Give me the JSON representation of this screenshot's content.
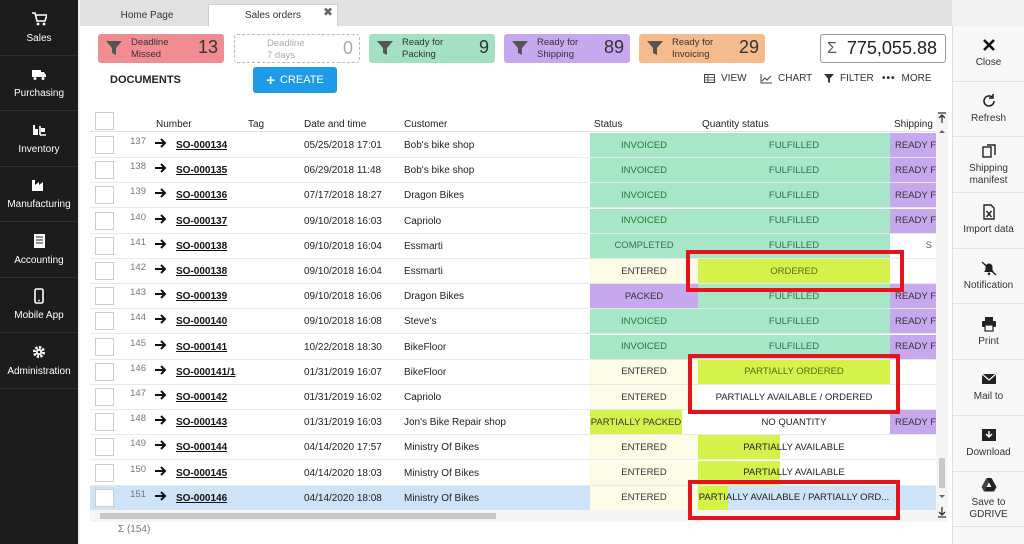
{
  "nav": {
    "items": [
      {
        "label": "Sales",
        "icon": "cart-icon"
      },
      {
        "label": "Purchasing",
        "icon": "truck-icon"
      },
      {
        "label": "Inventory",
        "icon": "forklift-icon"
      },
      {
        "label": "Manufacturing",
        "icon": "factory-icon"
      },
      {
        "label": "Accounting",
        "icon": "ledger-icon"
      },
      {
        "label": "Mobile App",
        "icon": "phone-icon"
      },
      {
        "label": "Administration",
        "icon": "gear-icon"
      }
    ]
  },
  "tabs": {
    "home": "Home Page",
    "sales": "Sales orders",
    "close": "✖"
  },
  "tiles": [
    {
      "line1": "Deadline",
      "line2": "Missed",
      "count": "13",
      "bg": "#f08c92",
      "text": "#333"
    },
    {
      "line1": "Deadline",
      "line2": "7 days",
      "count": "0",
      "bg": "#ffffff",
      "text": "#aaa"
    },
    {
      "line1": "Ready for",
      "line2": "Packing",
      "count": "9",
      "bg": "#a4e0c4",
      "text": "#333"
    },
    {
      "line1": "Ready for",
      "line2": "Shipping",
      "count": "89",
      "bg": "#c7a8ee",
      "text": "#333"
    },
    {
      "line1": "Ready for",
      "line2": "Invoicing",
      "count": "29",
      "bg": "#f6bb8c",
      "text": "#333"
    }
  ],
  "total": {
    "symbol": "Σ",
    "value": "775,055.88"
  },
  "toolbar": {
    "documents": "DOCUMENTS",
    "create": "CREATE",
    "view": "VIEW",
    "chart": "CHART",
    "filter": "FILTER",
    "more": "MORE"
  },
  "columns": {
    "number": "Number",
    "tag": "Tag",
    "datetime": "Date and time",
    "customer": "Customer",
    "status": "Status",
    "qty": "Quantity status",
    "shipping": "Shipping"
  },
  "colors": {
    "invoiced": "#a8e6c8",
    "fulfilled": "#a8e6c8",
    "completed": "#a8e6c8",
    "packed": "#c7a8ee",
    "ready": "#c7a8ee",
    "entered": "#fcfbe6",
    "ordered": "#d4f24a",
    "partially_packed": "#d4f24a",
    "highlight": "#e2141d",
    "accent": "#1e9be8"
  },
  "rows": [
    {
      "num": "137",
      "order": "SO-000134",
      "date": "05/25/2018 17:01",
      "customer": "Bob's bike shop",
      "status": "INVOICED",
      "qty": "FULFILLED",
      "ship": "READY F"
    },
    {
      "num": "138",
      "order": "SO-000135",
      "date": "06/29/2018 11:48",
      "customer": "Bob's bike shop",
      "status": "INVOICED",
      "qty": "FULFILLED",
      "ship": "READY F"
    },
    {
      "num": "139",
      "order": "SO-000136",
      "date": "07/17/2018 18:27",
      "customer": "Dragon Bikes",
      "status": "INVOICED",
      "qty": "FULFILLED",
      "ship": "READY F"
    },
    {
      "num": "140",
      "order": "SO-000137",
      "date": "09/10/2018 16:03",
      "customer": "Capriolo",
      "status": "INVOICED",
      "qty": "FULFILLED",
      "ship": "READY F"
    },
    {
      "num": "141",
      "order": "SO-000138",
      "date": "09/10/2018 16:04",
      "customer": "Essmarti",
      "status": "COMPLETED",
      "qty": "FULFILLED",
      "ship": "S"
    },
    {
      "num": "142",
      "order": "SO-000138",
      "date": "09/10/2018 16:04",
      "customer": "Essmarti",
      "status": "ENTERED",
      "qty": "ORDERED",
      "ship": ""
    },
    {
      "num": "143",
      "order": "SO-000139",
      "date": "09/10/2018 16:06",
      "customer": "Dragon Bikes",
      "status": "PACKED",
      "qty": "FULFILLED",
      "ship": "READY F"
    },
    {
      "num": "144",
      "order": "SO-000140",
      "date": "09/10/2018 16:08",
      "customer": "Steve's",
      "status": "INVOICED",
      "qty": "FULFILLED",
      "ship": "READY F"
    },
    {
      "num": "145",
      "order": "SO-000141",
      "date": "10/22/2018 18:30",
      "customer": "BikeFloor",
      "status": "INVOICED",
      "qty": "FULFILLED",
      "ship": "READY F"
    },
    {
      "num": "146",
      "order": "SO-000141/1",
      "date": "01/31/2019 16:07",
      "customer": "BikeFloor",
      "status": "ENTERED",
      "qty": "PARTIALLY ORDERED",
      "ship": ""
    },
    {
      "num": "147",
      "order": "SO-000142",
      "date": "01/31/2019 16:02",
      "customer": "Capriolo",
      "status": "ENTERED",
      "qty": "PARTIALLY AVAILABLE / ORDERED",
      "ship": ""
    },
    {
      "num": "148",
      "order": "SO-000143",
      "date": "01/31/2019 16:03",
      "customer": "Jon's Bike Repair shop",
      "status": "PARTIALLY PACKED",
      "qty": "NO QUANTITY",
      "ship": "READY F"
    },
    {
      "num": "149",
      "order": "SO-000144",
      "date": "04/14/2020 17:57",
      "customer": "Ministry Of Bikes",
      "status": "ENTERED",
      "qty": "PARTIALLY AVAILABLE",
      "ship": ""
    },
    {
      "num": "150",
      "order": "SO-000145",
      "date": "04/14/2020 18:03",
      "customer": "Ministry Of Bikes",
      "status": "ENTERED",
      "qty": "PARTIALLY AVAILABLE",
      "ship": ""
    },
    {
      "num": "151",
      "order": "SO-000146",
      "date": "04/14/2020 18:08",
      "customer": "Ministry Of Bikes",
      "status": "ENTERED",
      "qty": "PARTIALLY AVAILABLE / PARTIALLY ORD...",
      "ship": ""
    }
  ],
  "footer": {
    "count": "Σ (154)"
  },
  "actions": [
    {
      "label": "Close",
      "icon": "close-icon"
    },
    {
      "label": "Refresh",
      "icon": "refresh-icon"
    },
    {
      "label": "Shipping manifest",
      "icon": "copy-icon"
    },
    {
      "label": "Import data",
      "icon": "excel-icon"
    },
    {
      "label": "Notification",
      "icon": "bell-icon"
    },
    {
      "label": "Print",
      "icon": "printer-icon"
    },
    {
      "label": "Mail to",
      "icon": "mail-icon"
    },
    {
      "label": "Download",
      "icon": "download-icon"
    },
    {
      "label": "Save to GDRIVE",
      "icon": "gdrive-icon"
    }
  ]
}
